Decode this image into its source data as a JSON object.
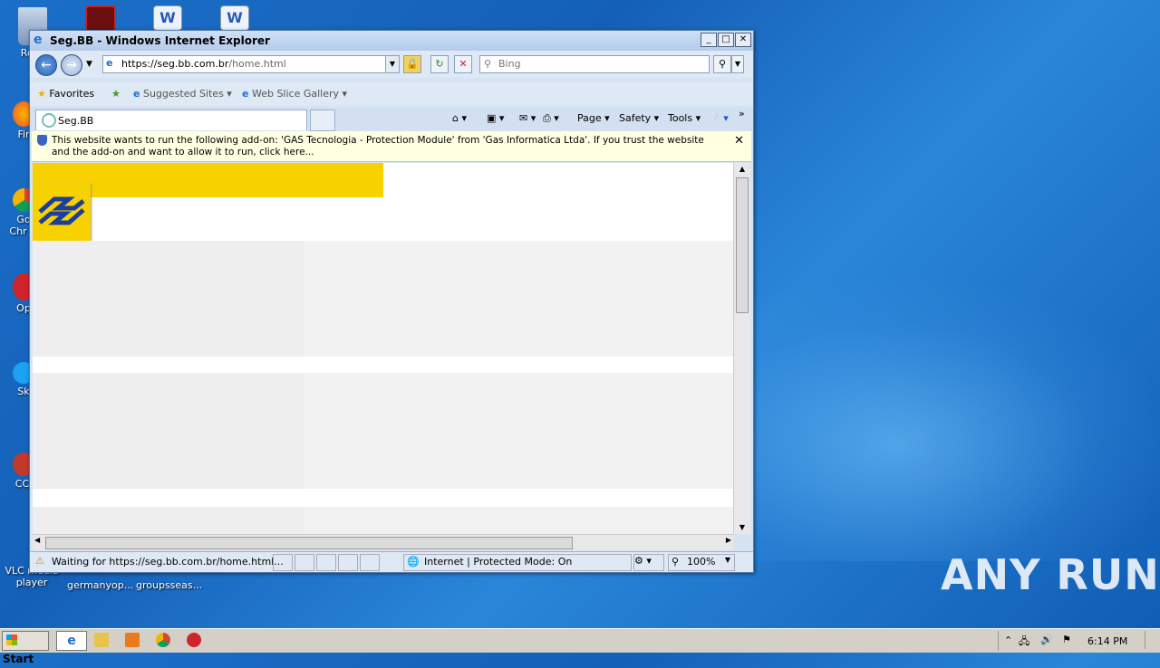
{
  "desktop": {
    "icons": [
      {
        "label": "Recy",
        "color": "#8aa4c8"
      },
      {
        "label": "Fir",
        "color": "#e8702a"
      },
      {
        "label": "Go\nChr",
        "color": "#2fa84f"
      },
      {
        "label": "Op",
        "color": "#d0242c"
      },
      {
        "label": "Sk",
        "color": "#1da1f2"
      },
      {
        "label": "CCl",
        "color": "#c0392b"
      },
      {
        "label": "VLC media player",
        "color": "#f28a1b"
      },
      {
        "label": "germanyop...",
        "color": "#ffffff"
      },
      {
        "label": "groupsseas...",
        "color": "#ffffff"
      }
    ],
    "watermark": "ANY RUN"
  },
  "window": {
    "title": "Seg.BB - Windows Internet Explorer",
    "controls": {
      "minimize": "_",
      "maximize": "□",
      "close": "✕"
    },
    "address": {
      "host": "https://seg.bb.com.br",
      "path": "/home.html"
    },
    "search_placeholder": "Bing",
    "favorites_label": "Favorites",
    "suggested_sites": "Suggested Sites",
    "web_slice": "Web Slice Gallery",
    "tab_title": "Seg.BB",
    "commands": {
      "page": "Page",
      "safety": "Safety",
      "tools": "Tools",
      "more": "»"
    },
    "infobar_text": "This website wants to run the following add-on: 'GAS Tecnologia - Protection Module' from 'Gas Informatica Ltda'. If you trust the website and the add-on and want to allow it to run, click here...",
    "infobar_close": "✕",
    "status": {
      "text": "Waiting for https://seg.bb.com.br/home.html...",
      "zone": "Internet | Protected Mode: On",
      "zoom": "100%"
    },
    "colors": {
      "brand_yellow": "#f7d200",
      "brand_blue": "#1d3f9a"
    }
  },
  "taskbar": {
    "start_label": "Start",
    "clock": "6:14 PM"
  }
}
